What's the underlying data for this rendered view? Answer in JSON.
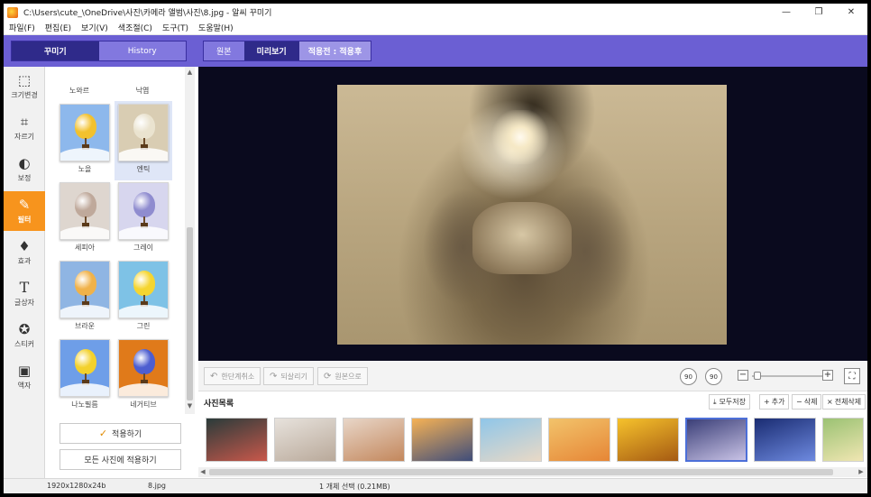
{
  "window": {
    "title": "C:\\Users\\cute_\\OneDrive\\사진\\카메라 앨범\\사진\\8.jpg - 알씨 꾸미기",
    "controls": [
      "—",
      "❐",
      "✕"
    ]
  },
  "menu": [
    "파일(F)",
    "편집(E)",
    "보기(V)",
    "색조절(C)",
    "도구(T)",
    "도움말(H)"
  ],
  "left_tabs": {
    "decorate": "꾸미기",
    "history": "History"
  },
  "view_tabs": {
    "original": "원본",
    "preview": "미리보기",
    "compare": "적용전 : 적용후"
  },
  "tools": [
    {
      "label": "크기변경",
      "icon": "resize-icon"
    },
    {
      "label": "자르기",
      "icon": "crop-icon"
    },
    {
      "label": "보정",
      "icon": "adjust-icon"
    },
    {
      "label": "필터",
      "icon": "filter-wand-icon",
      "active": true
    },
    {
      "label": "효과",
      "icon": "drop-icon"
    },
    {
      "label": "글상자",
      "icon": "text-icon"
    },
    {
      "label": "스티커",
      "icon": "sticker-icon"
    },
    {
      "label": "액자",
      "icon": "frame-icon"
    }
  ],
  "filters": {
    "partial_top": [
      "노와르",
      "낙엽"
    ],
    "items": [
      {
        "label": "노을",
        "balloon": "#f2c12e",
        "bg": "#8db8ec"
      },
      {
        "label": "엔틱",
        "balloon": "#eae3cf",
        "bg": "#d9cdb3",
        "selected": true
      },
      {
        "label": "세피아",
        "balloon": "#bfa99b",
        "bg": "#ded6cf"
      },
      {
        "label": "그레이",
        "balloon": "#8f8ccf",
        "bg": "#d7d6ee"
      },
      {
        "label": "브라운",
        "balloon": "#f0b24a",
        "bg": "#8fb5e3"
      },
      {
        "label": "그린",
        "balloon": "#f5d530",
        "bg": "#7ec2e6"
      },
      {
        "label": "나노필름",
        "balloon": "#f3d12c",
        "bg": "#6e9ee8"
      },
      {
        "label": "네거티브",
        "balloon": "#4d5ed0",
        "bg": "#e07a1a"
      }
    ]
  },
  "apply": {
    "apply_label": "적용하기",
    "apply_all_label": "모든 사진에 적용하기"
  },
  "actions": {
    "undo": "한단계취소",
    "redo": "되살리기",
    "original": "원본으로",
    "rotate_left": "90",
    "rotate_right": "90"
  },
  "photolist": {
    "title": "사진목록",
    "save_all": "모두저장",
    "add": "추가",
    "delete": "삭제",
    "delete_all": "전체삭제",
    "thumbs": [
      {
        "c1": "#2a3b3a",
        "c2": "#c9584b"
      },
      {
        "c1": "#e7e2dc",
        "c2": "#b9a99a"
      },
      {
        "c1": "#e8d6c8",
        "c2": "#c3875c"
      },
      {
        "c1": "#f6b255",
        "c2": "#3f4d7a"
      },
      {
        "c1": "#8fc6e9",
        "c2": "#e9d9c6"
      },
      {
        "c1": "#f2c36b",
        "c2": "#e68636"
      },
      {
        "c1": "#f6c22c",
        "c2": "#a55a12"
      },
      {
        "c1": "#3b3f78",
        "c2": "#c9c3e6",
        "selected": true
      },
      {
        "c1": "#1a2c72",
        "c2": "#6e8ae0"
      },
      {
        "c1": "#9bc273",
        "c2": "#f0e6b2"
      }
    ]
  },
  "status": {
    "resolution": "1920x1280x24b",
    "filename": "8.jpg",
    "selection": "1 개체 선택 (0.21MB)"
  }
}
